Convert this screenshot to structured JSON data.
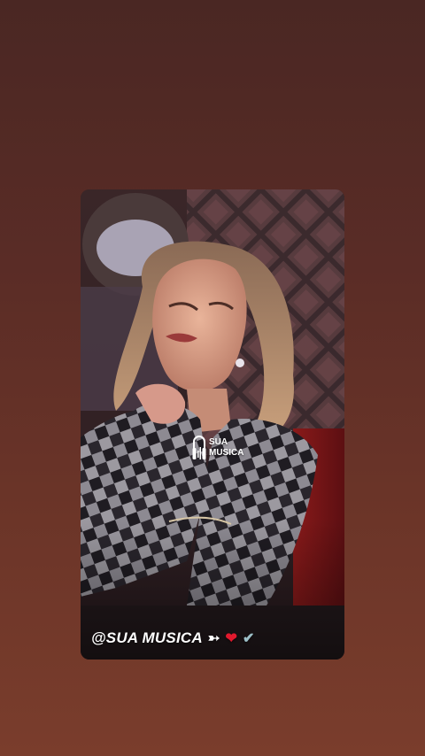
{
  "story": {
    "caption": {
      "handle": "@SUA MUSICA",
      "emojis": [
        {
          "name": "arrow-icon",
          "glyph": "➳"
        },
        {
          "name": "heart-icon",
          "glyph": "❤",
          "color": "#e0192d"
        },
        {
          "name": "check-icon",
          "glyph": "✔",
          "color": "#9dc0c8"
        }
      ]
    },
    "watermark": {
      "line1": "SUA",
      "line2": "MUSICA"
    }
  },
  "colors": {
    "background_top": "#4a2723",
    "background_bottom": "#7a3d2c",
    "heart": "#e0192d",
    "check": "#9dc0c8"
  }
}
